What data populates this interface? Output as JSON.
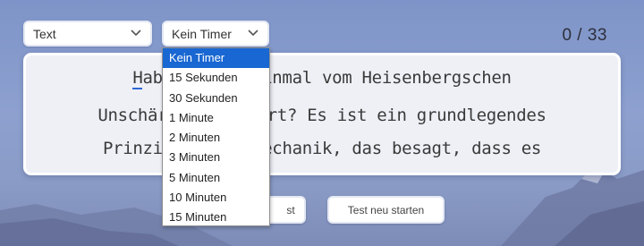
{
  "mode_select": {
    "value": "Text"
  },
  "timer_select": {
    "value": "Kein Timer",
    "options": [
      "Kein Timer",
      "15 Sekunden",
      "30 Sekunden",
      "1 Minute",
      "2 Minuten",
      "3 Minuten",
      "5 Minuten",
      "10 Minuten",
      "15 Minuten"
    ],
    "selected_index": 0
  },
  "counter": "0 / 33",
  "text_box": {
    "line1_first_char": "H",
    "line1_rest": "aben S     einmal vom Heisenbergschen",
    "line2": "Unschärfep     hört? Es ist ein grundlegendes",
    "line3": "Prinzip de     mechanik, das besagt, dass es"
  },
  "buttons": {
    "left_label": "st",
    "restart_label": "Test neu starten"
  },
  "colors": {
    "accent": "#1967d2",
    "caret": "#2f67d6",
    "background": "#8a9dcc"
  }
}
